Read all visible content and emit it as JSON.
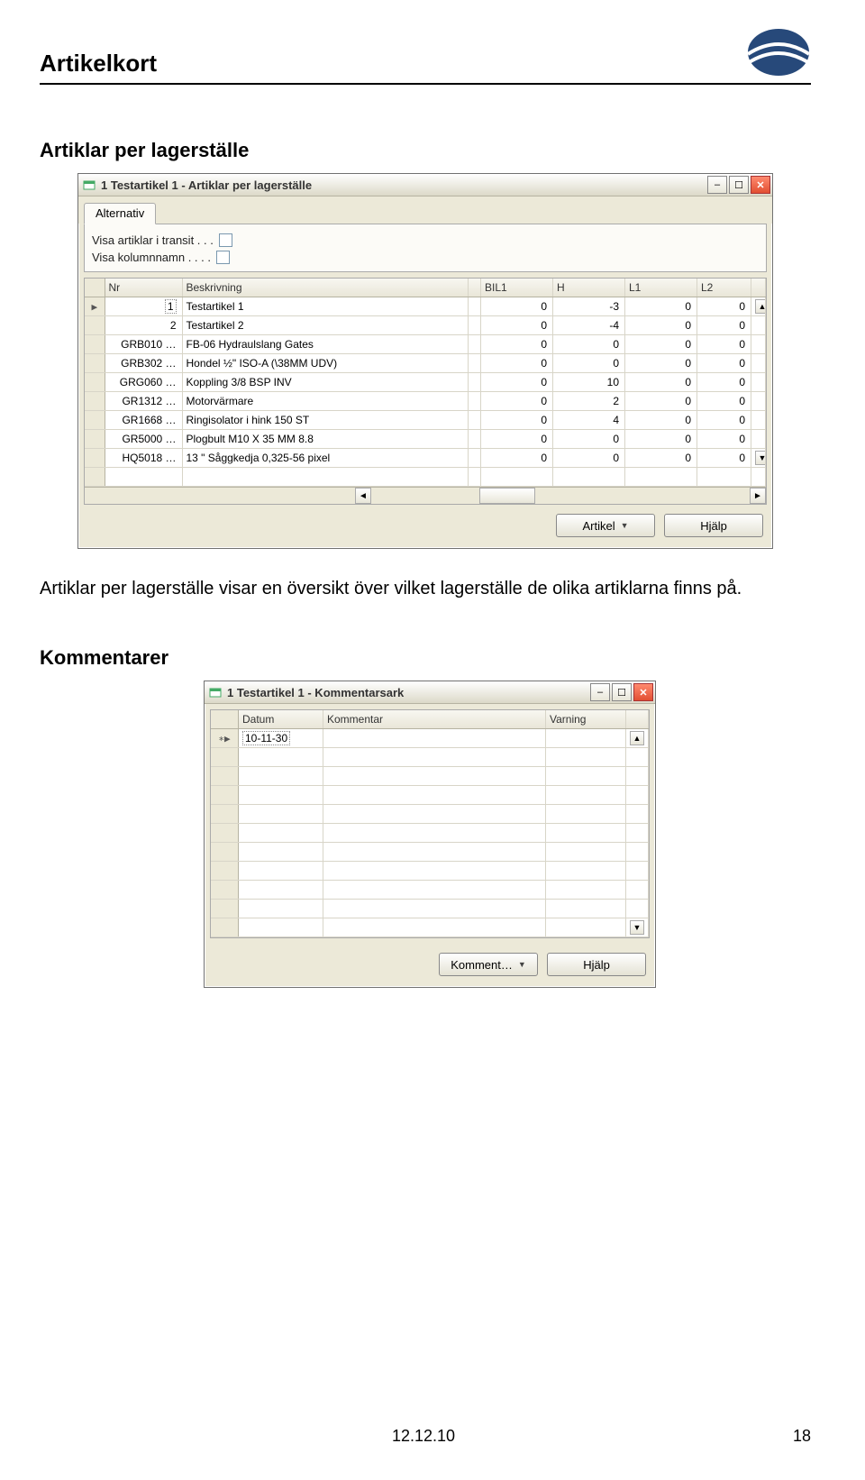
{
  "page": {
    "title": "Artikelkort",
    "section1_heading": "Artiklar per lagerställe",
    "body_text": "Artiklar per lagerställe visar en översikt över vilket lagerställe de olika artiklarna finns på.",
    "section2_heading": "Kommentarer",
    "footer_date": "12.12.10",
    "footer_page": "18"
  },
  "window1": {
    "title": "1 Testartikel 1 - Artiklar per lagerställe",
    "tab_label": "Alternativ",
    "check1_label": "Visa artiklar i transit .  .  .",
    "check2_label": "Visa kolumnnamn .  .  .  .",
    "columns": {
      "nr": "Nr",
      "beskr": "Beskrivning",
      "bil1": "BIL1",
      "h": "H",
      "l1": "L1",
      "l2": "L2"
    },
    "rows": [
      {
        "nr": "1",
        "beskr": "Testartikel 1",
        "bil1": "0",
        "h": "-3",
        "l1": "0",
        "l2": "0",
        "marker": "▶",
        "editing": true
      },
      {
        "nr": "2",
        "beskr": "Testartikel 2",
        "bil1": "0",
        "h": "-4",
        "l1": "0",
        "l2": "0"
      },
      {
        "nr": "GRB010 …",
        "beskr": "FB-06 Hydraulslang Gates",
        "bil1": "0",
        "h": "0",
        "l1": "0",
        "l2": "0"
      },
      {
        "nr": "GRB302 …",
        "beskr": "Hondel ½\" ISO-A (\\38MM UDV)",
        "bil1": "0",
        "h": "0",
        "l1": "0",
        "l2": "0"
      },
      {
        "nr": "GRG060 …",
        "beskr": "Koppling 3/8 BSP INV",
        "bil1": "0",
        "h": "10",
        "l1": "0",
        "l2": "0"
      },
      {
        "nr": "GR1312 …",
        "beskr": "Motorvärmare",
        "bil1": "0",
        "h": "2",
        "l1": "0",
        "l2": "0"
      },
      {
        "nr": "GR1668 …",
        "beskr": "Ringisolator i hink 150 ST",
        "bil1": "0",
        "h": "4",
        "l1": "0",
        "l2": "0"
      },
      {
        "nr": "GR5000 …",
        "beskr": "Plogbult M10 X 35 MM 8.8",
        "bil1": "0",
        "h": "0",
        "l1": "0",
        "l2": "0"
      },
      {
        "nr": "HQ5018 …",
        "beskr": "13 \" Såggkedja 0,325-56 pixel",
        "bil1": "0",
        "h": "0",
        "l1": "0",
        "l2": "0"
      }
    ],
    "btn_artikel": "Artikel",
    "btn_hjalp": "Hjälp"
  },
  "window2": {
    "title": "1 Testartikel 1 - Kommentarsark",
    "columns": {
      "datum": "Datum",
      "kommentar": "Kommentar",
      "varning": "Varning"
    },
    "row1": {
      "marker": "∗▶",
      "datum": "10-11-30"
    },
    "btn_komment": "Komment…",
    "btn_hjalp": "Hjälp"
  }
}
